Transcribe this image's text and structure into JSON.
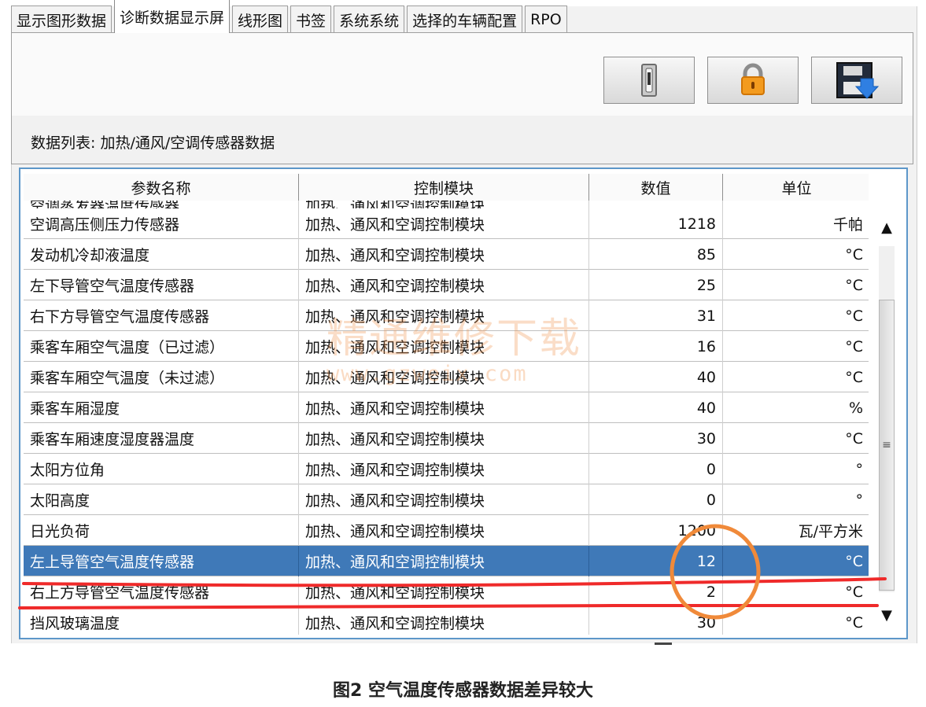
{
  "tabs": [
    {
      "label": "显示图形数据",
      "active": false
    },
    {
      "label": "诊断数据显示屏",
      "active": true
    },
    {
      "label": "线形图",
      "active": false
    },
    {
      "label": "书签",
      "active": false
    },
    {
      "label": "系统系统",
      "active": false
    },
    {
      "label": "选择的车辆配置",
      "active": false
    },
    {
      "label": "RPO",
      "active": false
    }
  ],
  "toolbar": {
    "buttons": [
      {
        "name": "switch-icon"
      },
      {
        "name": "lock-icon"
      },
      {
        "name": "save-icon"
      }
    ]
  },
  "section": {
    "title": "数据列表: 加热/通风/空调传感器数据"
  },
  "table": {
    "headers": [
      "参数名称",
      "控制模块",
      "数值",
      "单位"
    ],
    "partial_row": [
      "空调蒸发器温度传感器",
      "加热、通风和空调控制模块",
      "",
      ""
    ],
    "rows": [
      {
        "name": "空调高压侧压力传感器",
        "module": "加热、通风和空调控制模块",
        "value": "1218",
        "unit": "千帕",
        "selected": false
      },
      {
        "name": "发动机冷却液温度",
        "module": "加热、通风和空调控制模块",
        "value": "85",
        "unit": "°C",
        "selected": false
      },
      {
        "name": "左下导管空气温度传感器",
        "module": "加热、通风和空调控制模块",
        "value": "25",
        "unit": "°C",
        "selected": false
      },
      {
        "name": "右下方导管空气温度传感器",
        "module": "加热、通风和空调控制模块",
        "value": "31",
        "unit": "°C",
        "selected": false
      },
      {
        "name": "乘客车厢空气温度（已过滤）",
        "module": "加热、通风和空调控制模块",
        "value": "16",
        "unit": "°C",
        "selected": false
      },
      {
        "name": "乘客车厢空气温度（未过滤）",
        "module": "加热、通风和空调控制模块",
        "value": "40",
        "unit": "°C",
        "selected": false
      },
      {
        "name": "乘客车厢湿度",
        "module": "加热、通风和空调控制模块",
        "value": "40",
        "unit": "%",
        "selected": false
      },
      {
        "name": "乘客车厢速度湿度器温度",
        "module": "加热、通风和空调控制模块",
        "value": "30",
        "unit": "°C",
        "selected": false
      },
      {
        "name": "太阳方位角",
        "module": "加热、通风和空调控制模块",
        "value": "0",
        "unit": "°",
        "selected": false
      },
      {
        "name": "太阳高度",
        "module": "加热、通风和空调控制模块",
        "value": "0",
        "unit": "°",
        "selected": false
      },
      {
        "name": "日光负荷",
        "module": "加热、通风和空调控制模块",
        "value": "1200",
        "unit": "瓦/平方米",
        "selected": false
      },
      {
        "name": "左上导管空气温度传感器",
        "module": "加热、通风和空调控制模块",
        "value": "12",
        "unit": "°C",
        "selected": true
      },
      {
        "name": "右上方导管空气温度传感器",
        "module": "加热、通风和空调控制模块",
        "value": "2",
        "unit": "°C",
        "selected": false
      },
      {
        "name": "挡风玻璃温度",
        "module": "加热、通风和空调控制模块",
        "value": "30",
        "unit": "°C",
        "selected": false
      }
    ]
  },
  "scrollbar": {
    "up": "▲",
    "down": "▼",
    "thumb": "≡"
  },
  "watermark": {
    "main": "精通维修下载",
    "sub": "www.gzweix.com"
  },
  "caption": "图2 空气温度传感器数据差异较大",
  "colors": {
    "selected_row": "#3f79b8",
    "table_border": "#5d97c9",
    "annotation": "#ef2a2a",
    "circle": "#f08a3a"
  }
}
